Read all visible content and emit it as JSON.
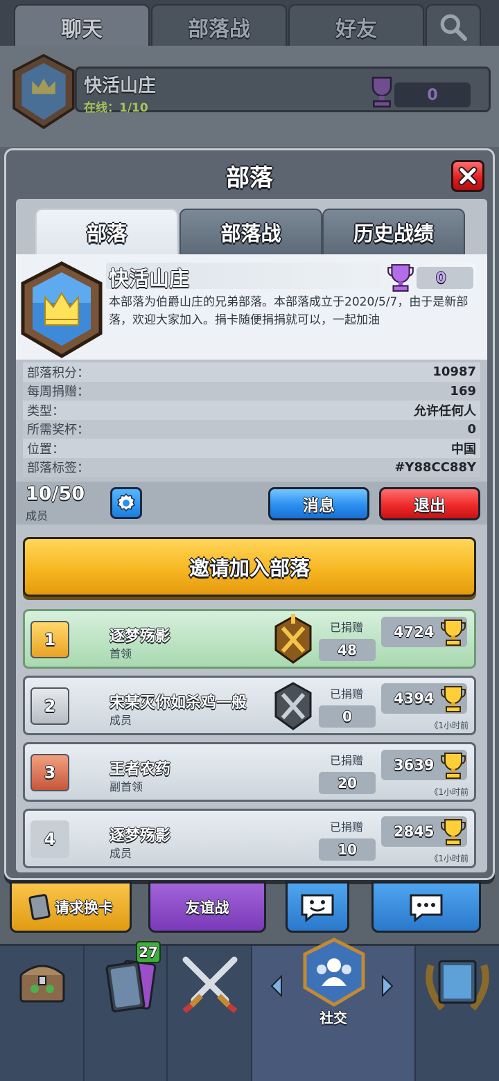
{
  "top_tabs": {
    "chat": "聊天",
    "clan_war": "部落战",
    "friends": "好友"
  },
  "bg_clan": {
    "name": "快活山庄",
    "online": "在线：1/10",
    "trophies": "0"
  },
  "modal": {
    "title": "部落",
    "tabs": [
      "部落",
      "部落战",
      "历史战绩"
    ],
    "clan": {
      "name": "快活山庄",
      "trophies": "0",
      "description": "本部落为伯爵山庄的兄弟部落。本部落成立于2020/5/7，由于是新部落，欢迎大家加入。捐卡随便捐捐就可以，一起加油"
    },
    "stats": [
      {
        "label": "部落积分：",
        "value": "10987"
      },
      {
        "label": "每周捐赠：",
        "value": "169"
      },
      {
        "label": "类型：",
        "value": "允许任何人"
      },
      {
        "label": "所需奖杯：",
        "value": "0"
      },
      {
        "label": "位置：",
        "value": "中国"
      },
      {
        "label": "部落标签：",
        "value": "#Y88CC88Y"
      }
    ],
    "member_count": "10/50",
    "member_label": "成员",
    "message_button": "消息",
    "leave_button": "退出",
    "invite_button": "邀请加入部落",
    "members": [
      {
        "rank": "1",
        "name": "逐梦殇影",
        "role": "首领",
        "donated_label": "已捐赠",
        "donated": "48",
        "trophies": "4724",
        "last_seen": ""
      },
      {
        "rank": "2",
        "name": "宋某灭你如杀鸡一般",
        "role": "成员",
        "donated_label": "已捐赠",
        "donated": "0",
        "trophies": "4394",
        "last_seen": "《1小时前"
      },
      {
        "rank": "3",
        "name": "王者农药",
        "role": "副首领",
        "donated_label": "已捐赠",
        "donated": "20",
        "trophies": "3639",
        "last_seen": "《1小时前"
      },
      {
        "rank": "4",
        "name": "逐梦殇影",
        "role": "成员",
        "donated_label": "已捐赠",
        "donated": "10",
        "trophies": "2845",
        "last_seen": "《1小时前"
      }
    ]
  },
  "bottom_buttons": {
    "request_cards": "请求换卡",
    "friendly_battle": "友谊战"
  },
  "nav": {
    "cards_badge": "27",
    "social_label": "社交"
  },
  "colors": {
    "gold_button": "#f7b722",
    "blue_button": "#2a8ff0",
    "red_button": "#ef2a2a",
    "leader_row": "#a8d9b0"
  }
}
